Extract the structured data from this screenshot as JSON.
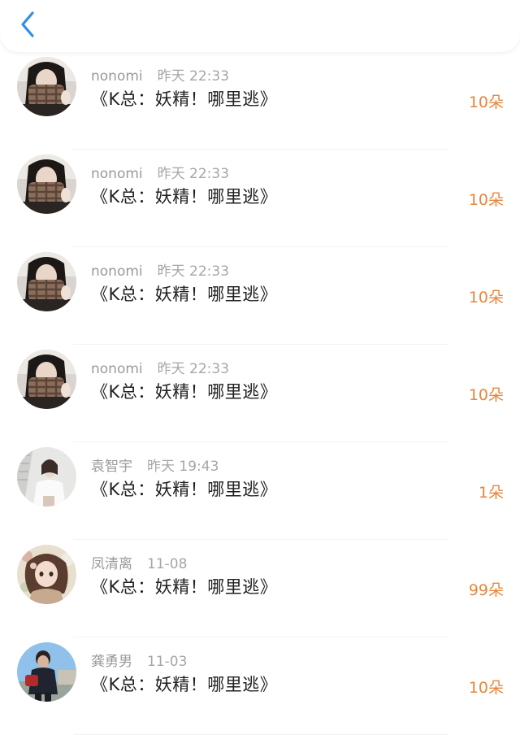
{
  "header": {
    "back_icon": "chevron-left-icon",
    "accent_color": "#2f8ee8"
  },
  "colors": {
    "amount": "#e9853c",
    "meta": "#9a9a9a",
    "title": "#1f1f1f"
  },
  "gifts": [
    {
      "user": "nonomi",
      "time": "昨天 22:33",
      "title": "《K总：妖精！哪里逃》",
      "amount": "10朵",
      "avatar": "scarf-portrait"
    },
    {
      "user": "nonomi",
      "time": "昨天 22:33",
      "title": "《K总：妖精！哪里逃》",
      "amount": "10朵",
      "avatar": "scarf-portrait"
    },
    {
      "user": "nonomi",
      "time": "昨天 22:33",
      "title": "《K总：妖精！哪里逃》",
      "amount": "10朵",
      "avatar": "scarf-portrait"
    },
    {
      "user": "nonomi",
      "time": "昨天 22:33",
      "title": "《K总：妖精！哪里逃》",
      "amount": "10朵",
      "avatar": "scarf-portrait"
    },
    {
      "user": "袁智宇",
      "time": "昨天 19:43",
      "title": "《K总：妖精！哪里逃》",
      "amount": "1朵",
      "avatar": "white-shirt-portrait"
    },
    {
      "user": "凤清离",
      "time": "11-08",
      "title": "《K总：妖精！哪里逃》",
      "amount": "99朵",
      "avatar": "anime-girl-portrait"
    },
    {
      "user": "龚勇男",
      "time": "11-03",
      "title": "《K总：妖精！哪里逃》",
      "amount": "10朵",
      "avatar": "outdoor-portrait"
    }
  ]
}
